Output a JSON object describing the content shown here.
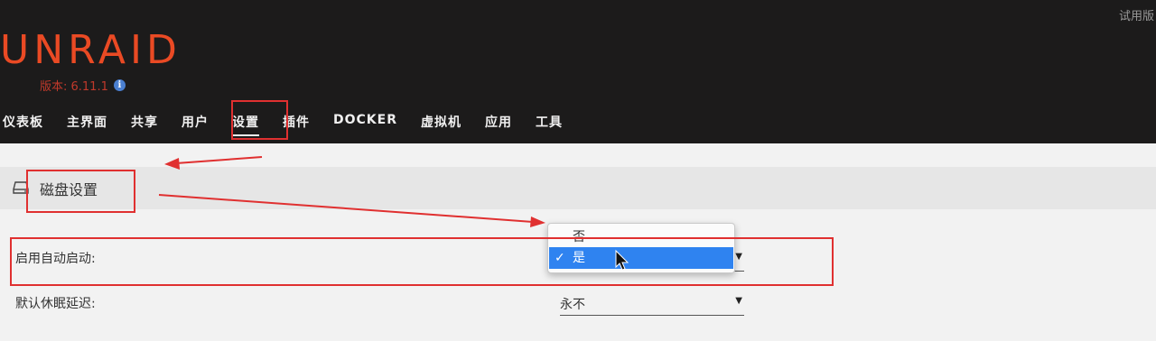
{
  "header": {
    "trial_label": "试用版",
    "logo_text": "UNRAID",
    "version_label": "版本: 6.11.1"
  },
  "nav": {
    "items": [
      "仪表板",
      "主界面",
      "共享",
      "用户",
      "设置",
      "插件",
      "DOCKER",
      "虚拟机",
      "应用",
      "工具"
    ],
    "active_index": 4
  },
  "section": {
    "title": "磁盘设置"
  },
  "rows": [
    {
      "label": "启用自动启动:",
      "value": "是"
    },
    {
      "label": "默认休眠延迟:",
      "value": "永不"
    }
  ],
  "dropdown": {
    "options": [
      "否",
      "是"
    ],
    "selected_index": 1
  },
  "colors": {
    "header_bg": "#1c1b1b",
    "brand": "#ea4a24",
    "annotation_red": "#e03030",
    "selection_blue": "#2f83f0"
  }
}
